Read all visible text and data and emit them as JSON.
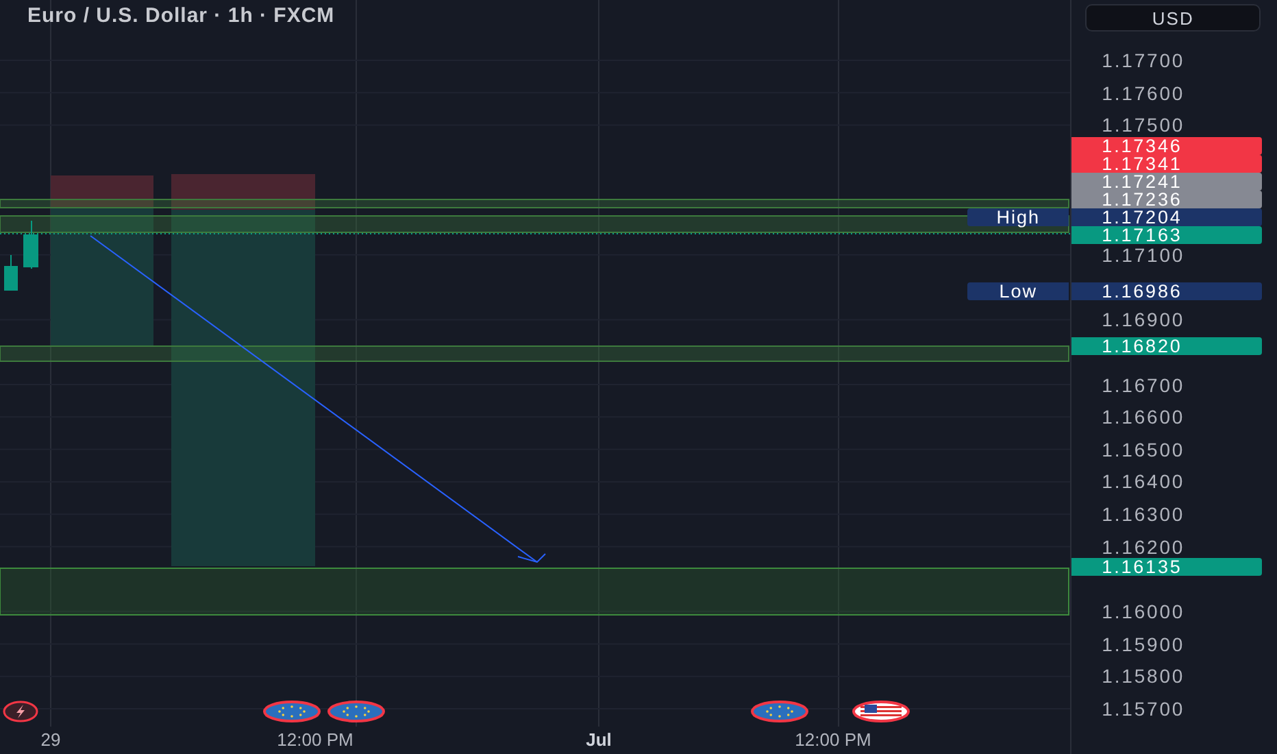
{
  "chart": {
    "title": "Euro / U.S. Dollar · 1h · FXCM",
    "currency_button": "USD",
    "price_ticks": [
      "1.17700",
      "1.17600",
      "1.17500",
      "1.17100",
      "1.16900",
      "1.16700",
      "1.16600",
      "1.16500",
      "1.16400",
      "1.16300",
      "1.16200",
      "1.16000",
      "1.15900",
      "1.15800",
      "1.15700"
    ],
    "price_tags": [
      {
        "value": "1.17346",
        "color": "#f23645"
      },
      {
        "value": "1.17341",
        "color": "#f23645"
      },
      {
        "value": "1.17241",
        "color": "#868993"
      },
      {
        "value": "1.17236",
        "color": "#868993"
      },
      {
        "label": "High",
        "value": "1.17204",
        "color": "#1c3468"
      },
      {
        "value": "1.17163",
        "color": "#089981"
      },
      {
        "label": "Low",
        "value": "1.16986",
        "color": "#1c3468"
      },
      {
        "value": "1.16820",
        "color": "#089981"
      },
      {
        "value": "1.16135",
        "color": "#089981"
      }
    ],
    "time_labels": [
      {
        "text": "29",
        "bold": false
      },
      {
        "text": "12:00 PM",
        "bold": false
      },
      {
        "text": "Jul",
        "bold": true
      },
      {
        "text": "12:00 PM",
        "bold": false
      }
    ],
    "events": [
      {
        "kind": "lightning"
      },
      {
        "kind": "eu"
      },
      {
        "kind": "eu"
      },
      {
        "kind": "eu"
      },
      {
        "kind": "us"
      }
    ]
  }
}
